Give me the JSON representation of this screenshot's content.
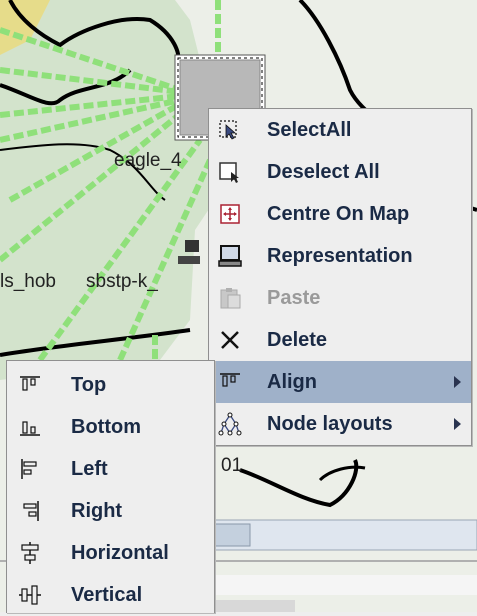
{
  "map": {
    "node_label_1": "eagle_4",
    "node_label_2": "ls_hob",
    "node_label_2b": "sbstp-k_",
    "node_label_3": "01"
  },
  "context_menu": {
    "items": [
      {
        "label": "SelectAll",
        "icon": "select-all-icon",
        "enabled": true
      },
      {
        "label": "Deselect All",
        "icon": "deselect-all-icon",
        "enabled": true
      },
      {
        "label": "Centre On Map",
        "icon": "centre-on-map-icon",
        "enabled": true
      },
      {
        "label": "Representation",
        "icon": "representation-icon",
        "enabled": true
      },
      {
        "label": "Paste",
        "icon": "paste-icon",
        "enabled": false
      },
      {
        "label": "Delete",
        "icon": "delete-icon",
        "enabled": true
      },
      {
        "label": "Align",
        "icon": "align-icon",
        "enabled": true,
        "submenu": true,
        "highlighted": true
      },
      {
        "label": "Node layouts",
        "icon": "node-layouts-icon",
        "enabled": true,
        "submenu": true
      }
    ]
  },
  "align_submenu": {
    "items": [
      {
        "label": "Top",
        "icon": "align-top-icon"
      },
      {
        "label": "Bottom",
        "icon": "align-bottom-icon"
      },
      {
        "label": "Left",
        "icon": "align-left-icon"
      },
      {
        "label": "Right",
        "icon": "align-right-icon"
      },
      {
        "label": "Horizontal",
        "icon": "align-horizontal-icon"
      },
      {
        "label": "Vertical",
        "icon": "align-vertical-icon"
      }
    ]
  },
  "colors": {
    "menu_background": "#eeeeee",
    "highlight": "#9fb1c9",
    "map_land": "#d3e3cc",
    "map_sand": "#e6dc8a",
    "link_green": "#8fe07a"
  }
}
